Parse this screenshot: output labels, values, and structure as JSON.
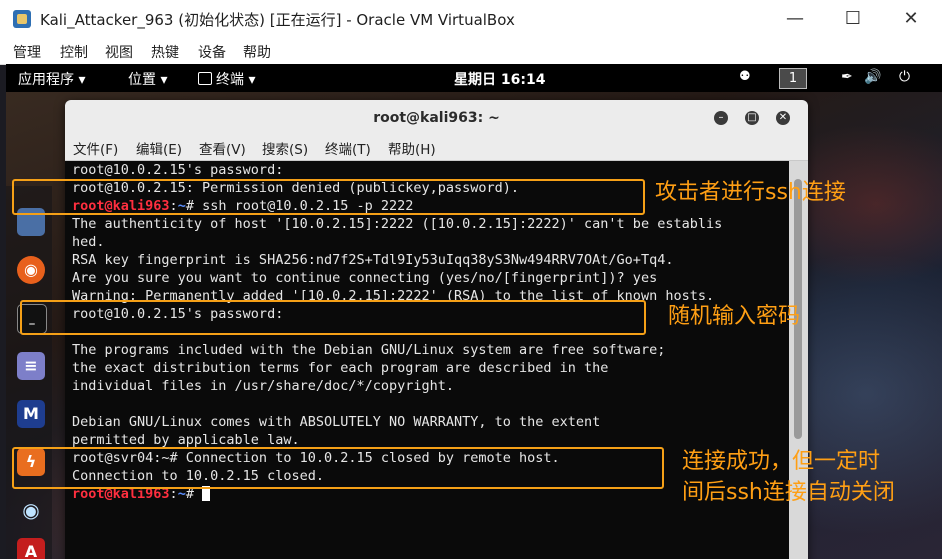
{
  "host_window": {
    "title": "Kali_Attacker_963 (初始化状态) [正在运行] - Oracle VM VirtualBox",
    "menu": [
      "管理",
      "控制",
      "视图",
      "热键",
      "设备",
      "帮助"
    ],
    "controls": [
      "—",
      "☐",
      "✕"
    ]
  },
  "guest_topbar": {
    "apps": "应用程序 ▾",
    "places": "位置 ▾",
    "terminal": "终端 ▾",
    "clock": "星期日 16:14",
    "workspace": "1"
  },
  "terminal": {
    "title": "root@kali963: ~",
    "menu": [
      "文件(F)",
      "编辑(E)",
      "查看(V)",
      "搜索(S)",
      "终端(T)",
      "帮助(H)"
    ]
  },
  "lines": [
    "root@10.0.2.15's password:",
    "root@10.0.2.15: Permission denied (publickey,password).",
    {
      "user": "root@kali963",
      "path": "~",
      "cmd": "# ssh root@10.0.2.15 -p 2222"
    },
    "The authenticity of host '[10.0.2.15]:2222 ([10.0.2.15]:2222)' can't be establis",
    "hed.",
    "RSA key fingerprint is SHA256:nd7f2S+Tdl9Iy53uIqq38yS3Nw494RRV7OAt/Go+Tq4.",
    "Are you sure you want to continue connecting (yes/no/[fingerprint])? yes",
    "Warning: Permanently added '[10.0.2.15]:2222' (RSA) to the list of known hosts.",
    "root@10.0.2.15's password:",
    "",
    "The programs included with the Debian GNU/Linux system are free software;",
    "the exact distribution terms for each program are described in the",
    "individual files in /usr/share/doc/*/copyright.",
    "",
    "Debian GNU/Linux comes with ABSOLUTELY NO WARRANTY, to the extent",
    "permitted by applicable law.",
    "root@svr04:~# Connection to 10.0.2.15 closed by remote host.",
    "Connection to 10.0.2.15 closed.",
    {
      "user": "root@kali963",
      "path": "~",
      "cmd": "# "
    }
  ],
  "annotations": {
    "a1": "攻击者进行ssh连接",
    "a2": "随机输入密码",
    "a3_line1": "连接成功，但一定时",
    "a3_line2": "间后ssh连接自动关闭"
  },
  "colors": {
    "annotation": "#ff9f14",
    "highlight_box": "#f5a017",
    "prompt_user": "#ff2f3f",
    "prompt_path": "#5b8fff"
  },
  "icons": {
    "dock": [
      "files-icon",
      "firefox-icon",
      "terminal-icon",
      "text-editor-icon",
      "metasploit-icon",
      "burpsuite-icon",
      "eye-icon",
      "pdf-icon"
    ],
    "tray": [
      "users-icon",
      "pen-icon",
      "volume-icon",
      "power-icon"
    ]
  }
}
